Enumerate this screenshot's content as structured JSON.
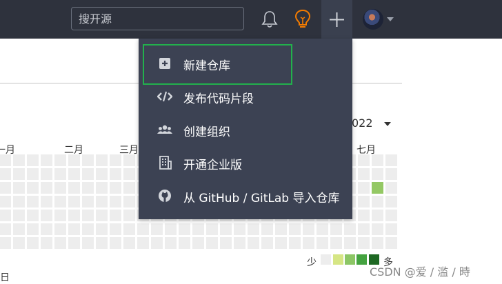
{
  "header": {
    "search_placeholder": "搜开源",
    "bell_icon": "bell-icon",
    "bulb_icon": "lightbulb-icon",
    "plus_icon": "plus-icon",
    "accent_color": "#f57c00"
  },
  "dropdown": {
    "items": [
      {
        "label": "新建仓库",
        "icon": "plus-square-icon"
      },
      {
        "label": "发布代码片段",
        "icon": "code-icon"
      },
      {
        "label": "创建组织",
        "icon": "users-icon"
      },
      {
        "label": "开通企业版",
        "icon": "building-icon"
      },
      {
        "label": "从 GitHub / GitLab 导入仓库",
        "icon": "github-icon"
      }
    ],
    "highlight_color": "#22b14c"
  },
  "contributions": {
    "year_label": "022",
    "months": [
      "一月",
      "二月",
      "三月",
      "七月"
    ],
    "legend_less": "少",
    "legend_more": "多",
    "legend_colors": [
      "#ededed",
      "#d6e685",
      "#8cc665",
      "#44a340",
      "#1e6823"
    ],
    "bottom_text": "日"
  },
  "watermark": "CSDN @爱 / 滥 / 時"
}
